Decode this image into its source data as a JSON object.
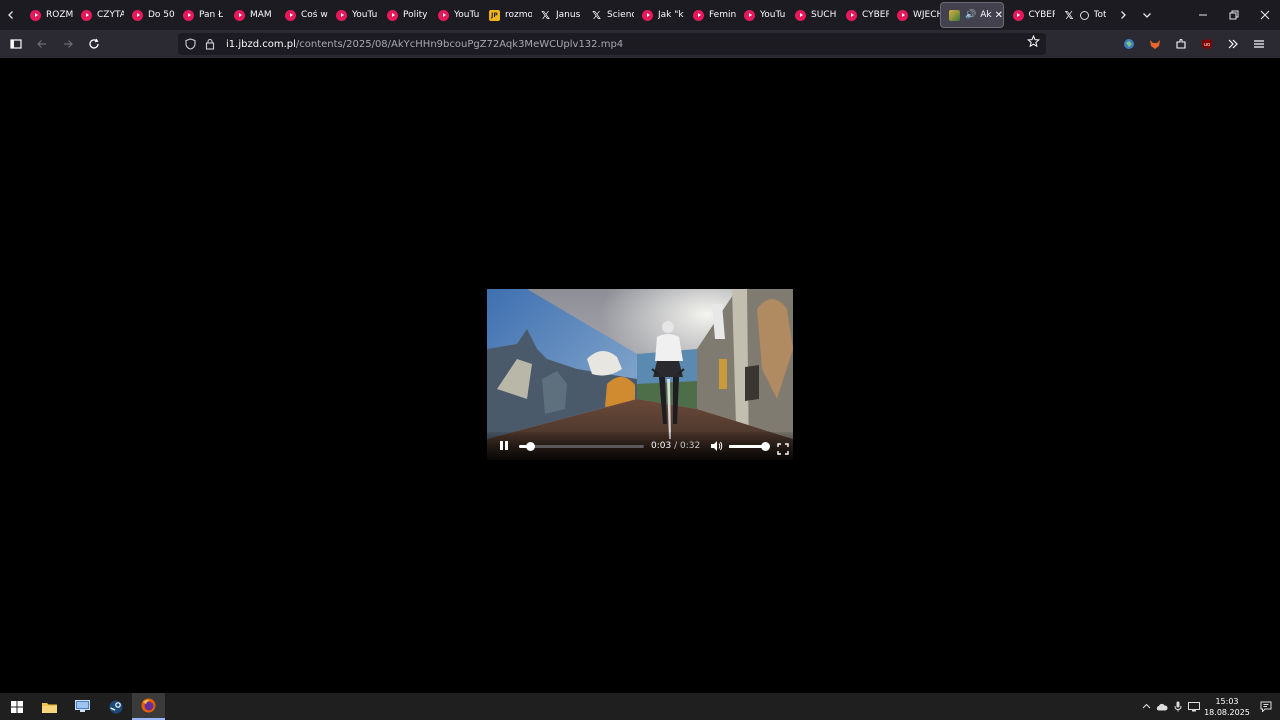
{
  "tabs": [
    {
      "icon": "youtube-favicon",
      "title": "ROZM"
    },
    {
      "icon": "youtube-favicon",
      "title": "CZYTA"
    },
    {
      "icon": "youtube-favicon",
      "title": "Do 50"
    },
    {
      "icon": "youtube-favicon",
      "title": "Pan Ł"
    },
    {
      "icon": "youtube-favicon",
      "title": "MAM"
    },
    {
      "icon": "youtube-favicon",
      "title": "Coś w"
    },
    {
      "icon": "youtube-favicon",
      "title": "YouTu"
    },
    {
      "icon": "youtube-favicon",
      "title": "Polity"
    },
    {
      "icon": "youtube-favicon",
      "title": "YouTu"
    },
    {
      "icon": "jp-favicon",
      "title": "rozmo"
    },
    {
      "icon": "x-favicon",
      "title": "Janus"
    },
    {
      "icon": "x-favicon",
      "title": "Scienc"
    },
    {
      "icon": "youtube-favicon",
      "title": "Jak \"k"
    },
    {
      "icon": "youtube-favicon",
      "title": "Femin"
    },
    {
      "icon": "youtube-favicon",
      "title": "YouTu"
    },
    {
      "icon": "youtube-favicon",
      "title": "SUCH"
    },
    {
      "icon": "youtube-favicon",
      "title": "CYBER"
    },
    {
      "icon": "youtube-favicon",
      "title": "WJECH"
    },
    {
      "icon": "jbzd-favicon",
      "title": "AkY",
      "active": true,
      "playing_audio": true
    },
    {
      "icon": "youtube-favicon",
      "title": "CYBER"
    },
    {
      "icon": "x-favicon",
      "title": "Tota",
      "second_icon": "circle-icon"
    }
  ],
  "address_bar": {
    "host": "i1.jbzd.com.pl",
    "path": "/contents/2025/08/AkYcHHn9bcouPgZ72Aqk3MeWCUplv132.mp4"
  },
  "video": {
    "current_time": "0:03",
    "separator": "/",
    "duration": "0:32",
    "progress_fraction": 0.094,
    "volume_fraction": 1.0,
    "state": "playing"
  },
  "taskbar": {
    "time": "15:03",
    "date": "18.08.2025"
  },
  "colors": {
    "youtube": "#e8195a",
    "tabstrip_bg": "#1c1b22",
    "navbar_bg": "#2b2a33",
    "taskbar_bg": "#1f1f1f"
  }
}
